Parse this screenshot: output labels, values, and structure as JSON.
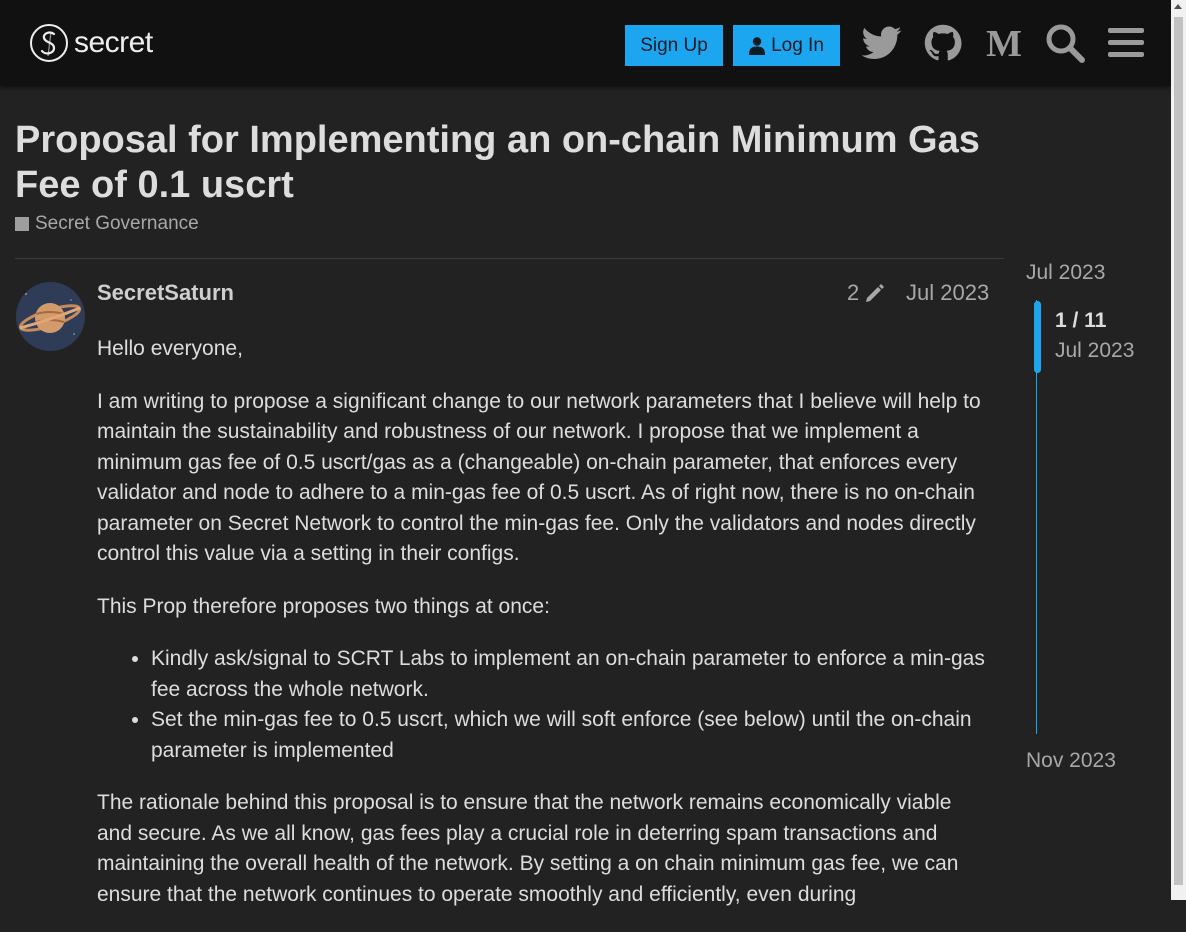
{
  "header": {
    "logo_text": "secret",
    "signup_label": "Sign Up",
    "login_label": "Log In",
    "icons": [
      "twitter-icon",
      "github-icon",
      "medium-icon",
      "search-icon",
      "menu-icon"
    ]
  },
  "topic": {
    "title": "Proposal for Implementing an on-chain Minimum Gas Fee of 0.1 uscrt",
    "category": "Secret Governance"
  },
  "post": {
    "username": "SecretSaturn",
    "edit_count": "2",
    "date": "Jul 2023",
    "paragraphs": [
      "Hello everyone,",
      "I am writing to propose a significant change to our network parameters that I believe will help to maintain the sustainability and robustness of our network. I propose that we implement a minimum gas fee of 0.5 uscrt/gas as a (changeable) on-chain parameter, that enforces every validator and node to adhere to a min-gas fee of 0.5 uscrt. As of right now, there is no on-chain parameter on Secret Network to control the min-gas fee. Only the validators and nodes directly control this value via a setting in their configs.",
      "This Prop therefore proposes two things at once:"
    ],
    "list": [
      "Kindly ask/signal to SCRT Labs to implement an on-chain parameter to enforce a min-gas fee across the whole network.",
      "Set the min-gas fee to 0.5 uscrt, which we will soft enforce (see below) until the on-chain parameter is implemented"
    ],
    "closing_paragraph": "The rationale behind this proposal is to ensure that the network remains economically viable and secure. As we all know, gas fees play a crucial role in deterring spam transactions and maintaining the overall health of the network. By setting a on chain minimum gas fee, we can ensure that the network continues to operate smoothly and efficiently, even during"
  },
  "timeline": {
    "start_date": "Jul 2023",
    "position": "1 / 11",
    "position_date": "Jul 2023",
    "end_date": "Nov 2023"
  }
}
